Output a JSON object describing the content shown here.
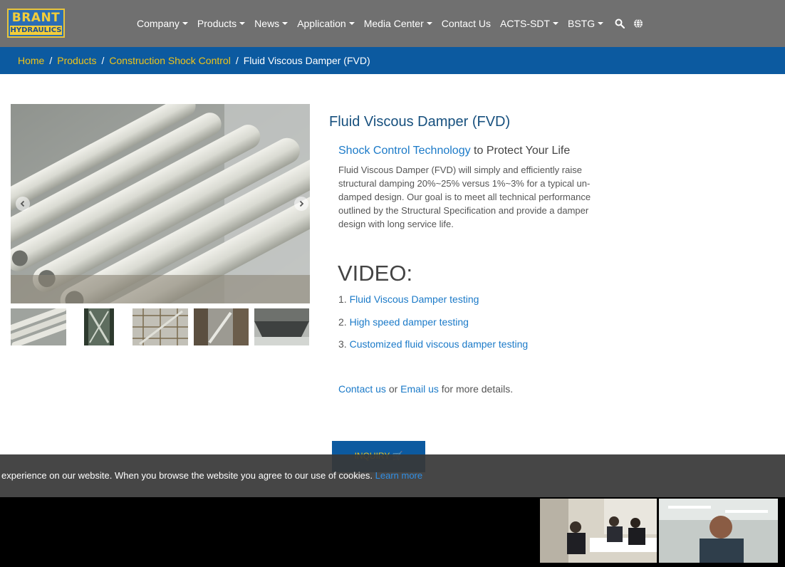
{
  "header": {
    "logo_line1": "BRANT",
    "logo_line2": "HYDRAULICS",
    "nav": [
      {
        "label": "Company"
      },
      {
        "label": "Products"
      },
      {
        "label": "News"
      },
      {
        "label": "Application"
      },
      {
        "label": "Media Center"
      },
      {
        "label": "Contact Us"
      },
      {
        "label": "ACTS-SDT"
      },
      {
        "label": "BSTG"
      }
    ],
    "icons": [
      "search-icon",
      "globe-icon"
    ]
  },
  "breadcrumb": {
    "items": [
      "Home",
      "Products",
      "Construction Shock Control"
    ],
    "current": "Fluid Viscous Damper (FVD)"
  },
  "product": {
    "title": "Fluid Viscous Damper (FVD)",
    "subhead_link": "Shock Control Technology",
    "subhead_rest": " to Protect Your Life",
    "description_lines": [
      "Fluid Viscous Damper (FVD) will simply and efficiently raise",
      "structural damping 20%~25% versus 1%~3% for a typical un-",
      "damped design. Our goal is to meet all technical performance",
      "outlined by the Structural Specification and provide a damper",
      "design with long service life."
    ],
    "video_heading": "VIDEO:",
    "videos": [
      {
        "num": "1. ",
        "label": "Fluid Viscous Damper testing"
      },
      {
        "num": "2. ",
        "label": "High speed damper testing"
      },
      {
        "num": "3. ",
        "label": "Customized fluid viscous damper testing"
      }
    ],
    "contact_link": "Contact us",
    "contact_or": " or ",
    "email_link": "Email us",
    "contact_rest": " for more details.",
    "inquiry_label": "INQUIRY"
  },
  "cookie": {
    "text": "experience on our website. When you browse the website you agree to our use of cookies. ",
    "learn_more": "Learn more"
  },
  "colors": {
    "header_bg": "#707070",
    "breadcrumb_bg": "#0c5aa0",
    "link_yellow": "#f0c419",
    "title_blue": "#17507e",
    "link_blue": "#1b7ac8"
  }
}
